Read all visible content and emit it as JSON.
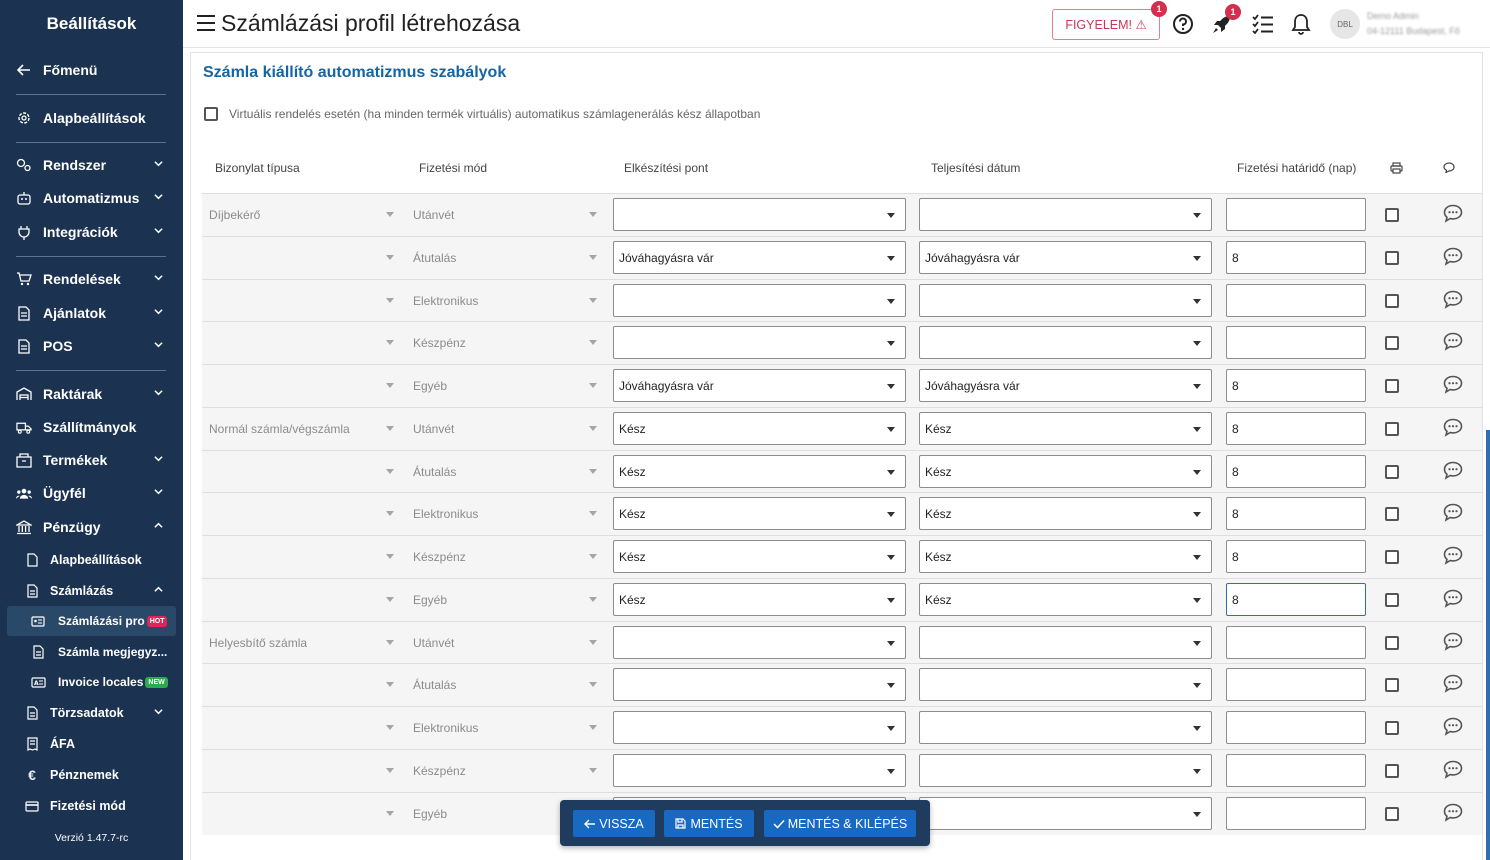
{
  "sidebar": {
    "title": "Beállítások",
    "items": [
      {
        "label": "Főmenü",
        "icon": "arrow-left-icon"
      },
      {
        "label": "Alapbeállítások",
        "icon": "gear-icon"
      },
      {
        "label": "Rendszer",
        "icon": "cogs-icon"
      },
      {
        "label": "Automatizmus",
        "icon": "robot-icon"
      },
      {
        "label": "Integrációk",
        "icon": "plug-icon"
      },
      {
        "label": "Rendelések",
        "icon": "cart-icon"
      },
      {
        "label": "Ajánlatok",
        "icon": "document-icon"
      },
      {
        "label": "POS",
        "icon": "document-icon"
      },
      {
        "label": "Raktárak",
        "icon": "warehouse-icon"
      },
      {
        "label": "Szállítmányok",
        "icon": "truck-icon"
      },
      {
        "label": "Termékek",
        "icon": "box-icon"
      },
      {
        "label": "Ügyfél",
        "icon": "users-icon"
      },
      {
        "label": "Pénzügy",
        "icon": "bank-icon"
      },
      {
        "label": "Alapbeállítások",
        "icon": "file-icon"
      },
      {
        "label": "Számlázás",
        "icon": "file-icon"
      },
      {
        "label": "Számlázási pro",
        "icon": "card-icon",
        "badge": "HOT"
      },
      {
        "label": "Számla megjegyz...",
        "icon": "file-icon"
      },
      {
        "label": "Invoice locales",
        "icon": "locale-icon",
        "badge": "NEW"
      },
      {
        "label": "Törzsadatok",
        "icon": "file-icon"
      },
      {
        "label": "ÁFA",
        "icon": "receipt-icon"
      },
      {
        "label": "Pénznemek",
        "icon": "euro-icon"
      },
      {
        "label": "Fizetési mód",
        "icon": "credit-card-icon"
      }
    ],
    "version": "Verzió 1.47.7-rc"
  },
  "header": {
    "title": "Számlázási profil létrehozása",
    "warning_label": "FIGYELEM! ⚠",
    "warning_count": "1",
    "rocket_count": "1",
    "user_name": "Demo Admin",
    "user_sub": "04-12111 Budapest, Fő"
  },
  "section": {
    "title": "Számla kiállító automatizmus szabályok",
    "virtual_label": "Virtuális rendelés esetén (ha minden termék virtuális) automatikus számlagenerálás kész állapotban"
  },
  "table": {
    "headers": {
      "type": "Bizonylat típusa",
      "payment": "Fizetési mód",
      "point": "Elkészítési pont",
      "date": "Teljesítési dátum",
      "deadline": "Fizetési határidő (nap)"
    },
    "rows": [
      {
        "type": "Díjbekérő",
        "payment": "Utánvét",
        "point": "",
        "date": "",
        "deadline": ""
      },
      {
        "type": "",
        "payment": "Átutalás",
        "point": "Jóváhagyásra vár",
        "date": "Jóváhagyásra vár",
        "deadline": "8"
      },
      {
        "type": "",
        "payment": "Elektronikus",
        "point": "",
        "date": "",
        "deadline": ""
      },
      {
        "type": "",
        "payment": "Készpénz",
        "point": "",
        "date": "",
        "deadline": ""
      },
      {
        "type": "",
        "payment": "Egyéb",
        "point": "Jóváhagyásra vár",
        "date": "Jóváhagyásra vár",
        "deadline": "8"
      },
      {
        "type": "Normál számla/végszámla",
        "payment": "Utánvét",
        "point": "Kész",
        "date": "Kész",
        "deadline": "8"
      },
      {
        "type": "",
        "payment": "Átutalás",
        "point": "Kész",
        "date": "Kész",
        "deadline": "8"
      },
      {
        "type": "",
        "payment": "Elektronikus",
        "point": "Kész",
        "date": "Kész",
        "deadline": "8"
      },
      {
        "type": "",
        "payment": "Készpénz",
        "point": "Kész",
        "date": "Kész",
        "deadline": "8"
      },
      {
        "type": "",
        "payment": "Egyéb",
        "point": "Kész",
        "date": "Kész",
        "deadline": "8"
      },
      {
        "type": "Helyesbítő számla",
        "payment": "Utánvét",
        "point": "",
        "date": "",
        "deadline": ""
      },
      {
        "type": "",
        "payment": "Átutalás",
        "point": "",
        "date": "",
        "deadline": ""
      },
      {
        "type": "",
        "payment": "Elektronikus",
        "point": "",
        "date": "",
        "deadline": ""
      },
      {
        "type": "",
        "payment": "Készpénz",
        "point": "",
        "date": "",
        "deadline": ""
      },
      {
        "type": "",
        "payment": "Egyéb",
        "point": "",
        "date": "",
        "deadline": ""
      }
    ]
  },
  "footer": {
    "back_label": "VISSZA",
    "save_label": "MENTÉS",
    "save_exit_label": "MENTÉS & KILÉPÉS"
  },
  "colors": {
    "sidebar_bg": "#1b3350",
    "accent": "#1769c2",
    "section_title": "#1565a5",
    "warning": "#c6375a"
  }
}
